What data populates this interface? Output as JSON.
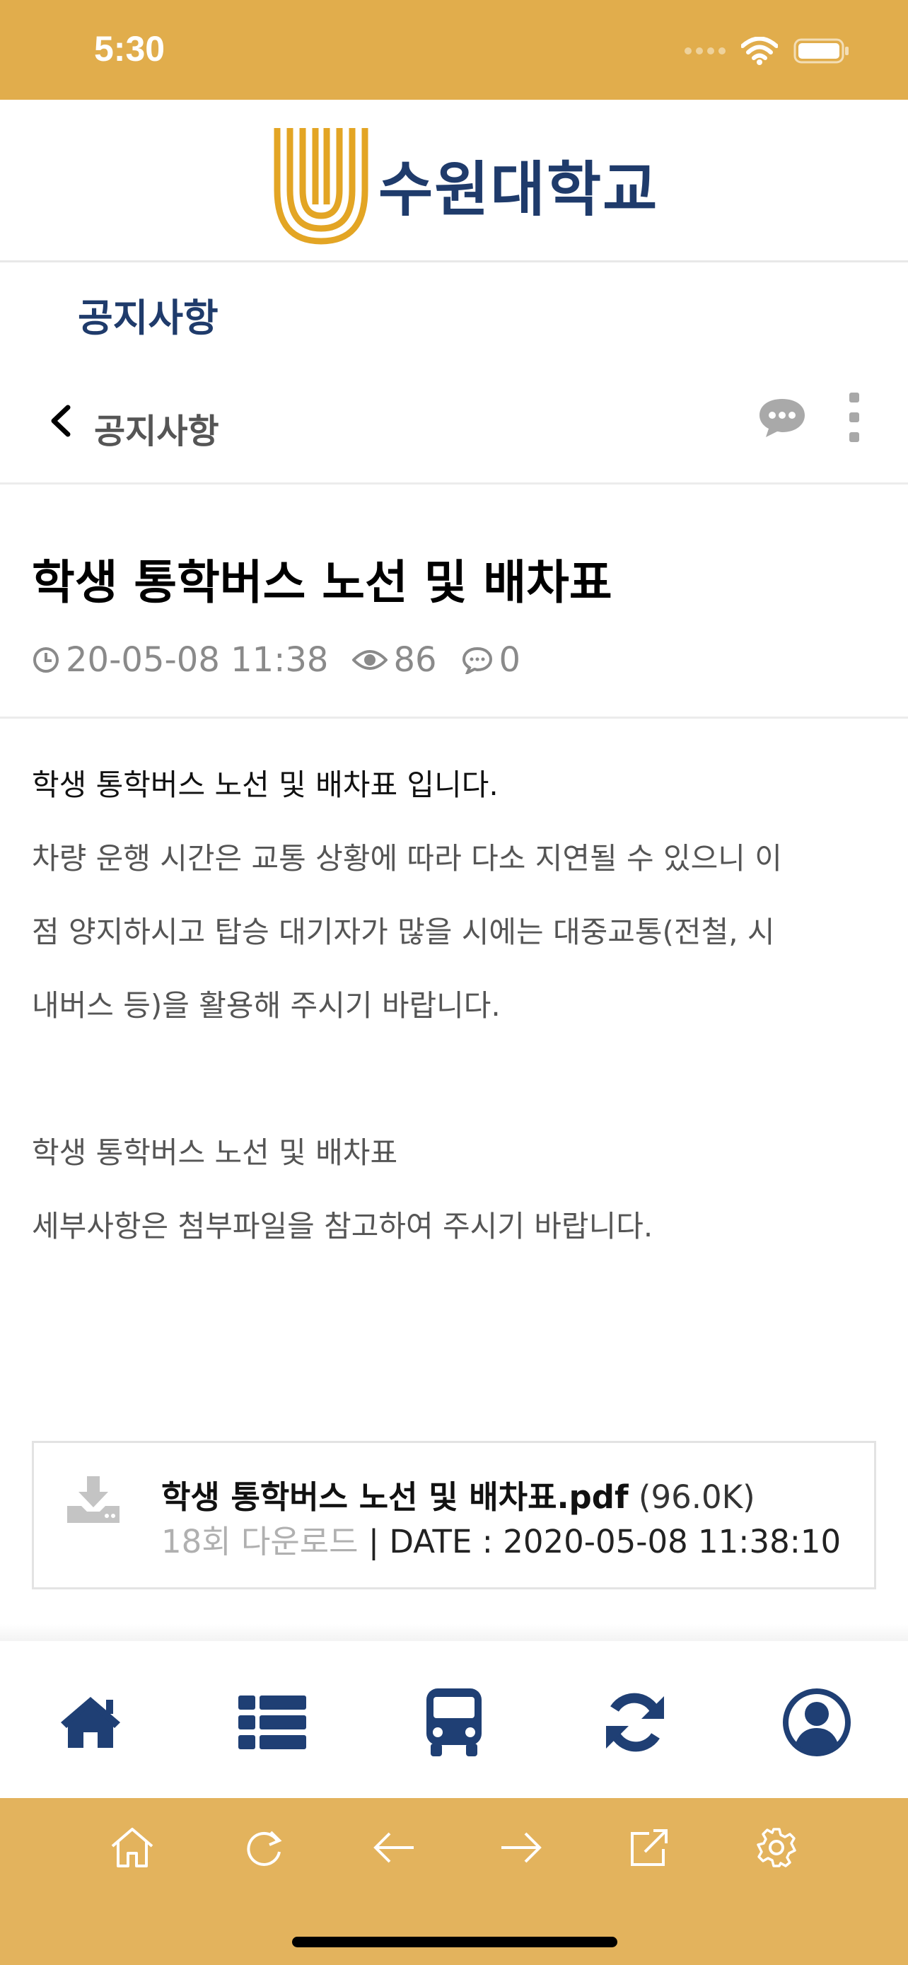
{
  "status_bar": {
    "time": "5:30"
  },
  "header": {
    "logo_text": "수원대학교",
    "section_title": "공지사항"
  },
  "nav": {
    "back_label": "공지사항"
  },
  "post": {
    "title": "학생 통학버스 노선 및 배차표",
    "date": "20-05-08 11:38",
    "views": "86",
    "comments": "0",
    "body_lines": [
      "학생 통학버스 노선 및 배차표 입니다.",
      "차량 운행 시간은 교통 상황에 따라 다소 지연될 수 있으니 이",
      "점 양지하시고 탑승 대기자가 많을 시에는 대중교통(전철, 시",
      "내버스 등)을 활용해 주시기 바랍니다.",
      "",
      "학생 통학버스 노선 및 배차표",
      "세부사항은 첨부파일을 참고하여 주시기 바랍니다."
    ]
  },
  "attachment": {
    "filename": "학생 통학버스 노선 및 배차표.pdf",
    "size": "(96.0K)",
    "download_count": "18회 다운로드",
    "separator": "|",
    "date": "DATE : 2020-05-08 11:38:10"
  },
  "tab_bar": {
    "icons": [
      "home-icon",
      "list-icon",
      "bus-icon",
      "refresh-icon",
      "profile-icon"
    ],
    "color": "#1f3f74"
  },
  "browser_bar": {
    "icons": [
      "home-icon",
      "reload-icon",
      "back-arrow-icon",
      "forward-arrow-icon",
      "share-icon",
      "settings-icon"
    ]
  },
  "colors": {
    "accent": "#e1ad4c",
    "navy": "#1f3b6b",
    "muted_text": "#8a8a8a"
  }
}
